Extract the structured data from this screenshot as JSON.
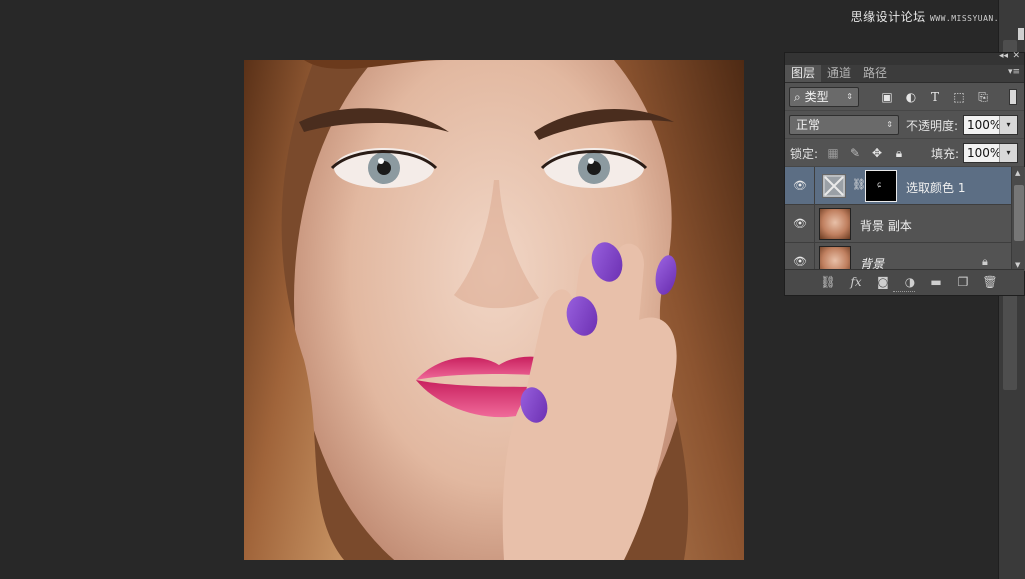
{
  "watermark": {
    "main": "思缘设计论坛",
    "sub": "WWW.MISSYUAN.COM"
  },
  "panel": {
    "collapse_icon": "double-chevron-left-icon",
    "close_icon": "close-icon",
    "tabs": [
      {
        "label": "图层",
        "active": true
      },
      {
        "label": "通道",
        "active": false
      },
      {
        "label": "路径",
        "active": false
      }
    ],
    "menu_icon": "panel-menu-icon",
    "filter": {
      "kind_label": "类型",
      "search_icon": "search-icon",
      "icons": [
        "image-filter-icon",
        "adjustment-filter-icon",
        "type-filter-icon",
        "shape-filter-icon",
        "smart-object-filter-icon"
      ]
    },
    "blend_mode": "正常",
    "opacity_label": "不透明度:",
    "opacity_value": "100%",
    "lock_label": "锁定:",
    "fill_label": "填充:",
    "fill_value": "100%",
    "layers": [
      {
        "name": "选取颜色 1",
        "type": "adjustment",
        "selected": true,
        "visible": true,
        "locked": false
      },
      {
        "name": "背景 副本",
        "type": "pixel",
        "selected": false,
        "visible": true,
        "locked": false
      },
      {
        "name": "背景",
        "type": "pixel",
        "selected": false,
        "visible": true,
        "locked": true
      }
    ],
    "footer_icons": [
      "link-layers-icon",
      "fx-icon",
      "add-mask-icon",
      "new-adjustment-icon",
      "new-group-icon",
      "new-layer-icon",
      "delete-icon"
    ]
  },
  "colors": {
    "workspace": "#282828",
    "panel_bg": "#535353",
    "selected_layer": "#5c6e84",
    "nail_purple": "#7a3fc0",
    "lip_pink": "#e0487e"
  }
}
